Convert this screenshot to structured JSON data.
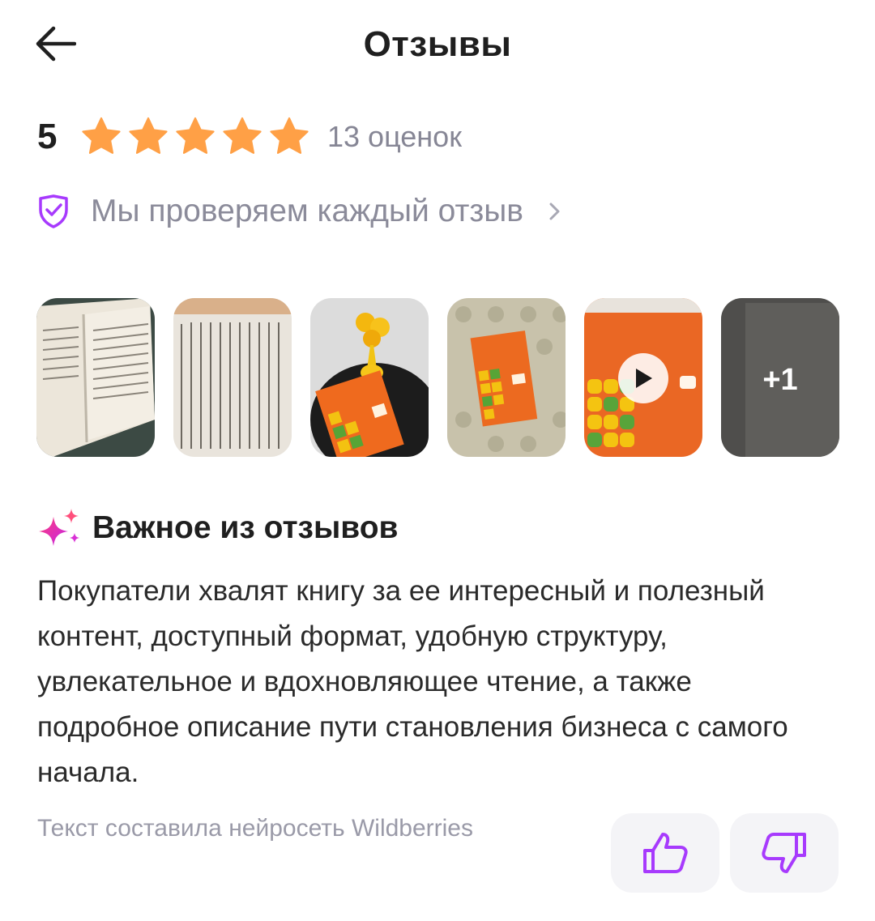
{
  "header": {
    "title": "Отзывы",
    "back_icon": "arrow-left-icon"
  },
  "rating": {
    "value": "5",
    "stars_filled": 5,
    "stars_total": 5,
    "count_label": "13 оценок",
    "star_color": "#FFA046"
  },
  "verification": {
    "label": "Мы проверяем каждый отзыв",
    "icon": "shield-check-icon",
    "accent_color": "#A73AFD"
  },
  "photos": {
    "items": [
      {
        "type": "photo",
        "description_icon": "photo-thumbnail"
      },
      {
        "type": "photo",
        "description_icon": "photo-thumbnail"
      },
      {
        "type": "photo",
        "description_icon": "photo-thumbnail"
      },
      {
        "type": "photo",
        "description_icon": "photo-thumbnail"
      },
      {
        "type": "video",
        "description_icon": "play-icon"
      },
      {
        "type": "more",
        "description_icon": "photo-thumbnail"
      }
    ],
    "more_label": "+1"
  },
  "summary": {
    "title": "Важное из отзывов",
    "icon": "sparkle-icon",
    "text": "Покупатели хвалят книгу за ее интересный и полезный контент, доступный формат, удобную структуру, увлекательное и вдохновляющее чтение, а также подробное описание пути становления бизнеса с самого начала.",
    "ai_note": "Текст составила нейросеть Wildberries"
  },
  "feedback": {
    "like_icon": "thumbs-up-icon",
    "dislike_icon": "thumbs-down-icon",
    "icon_color": "#A73AFD"
  }
}
